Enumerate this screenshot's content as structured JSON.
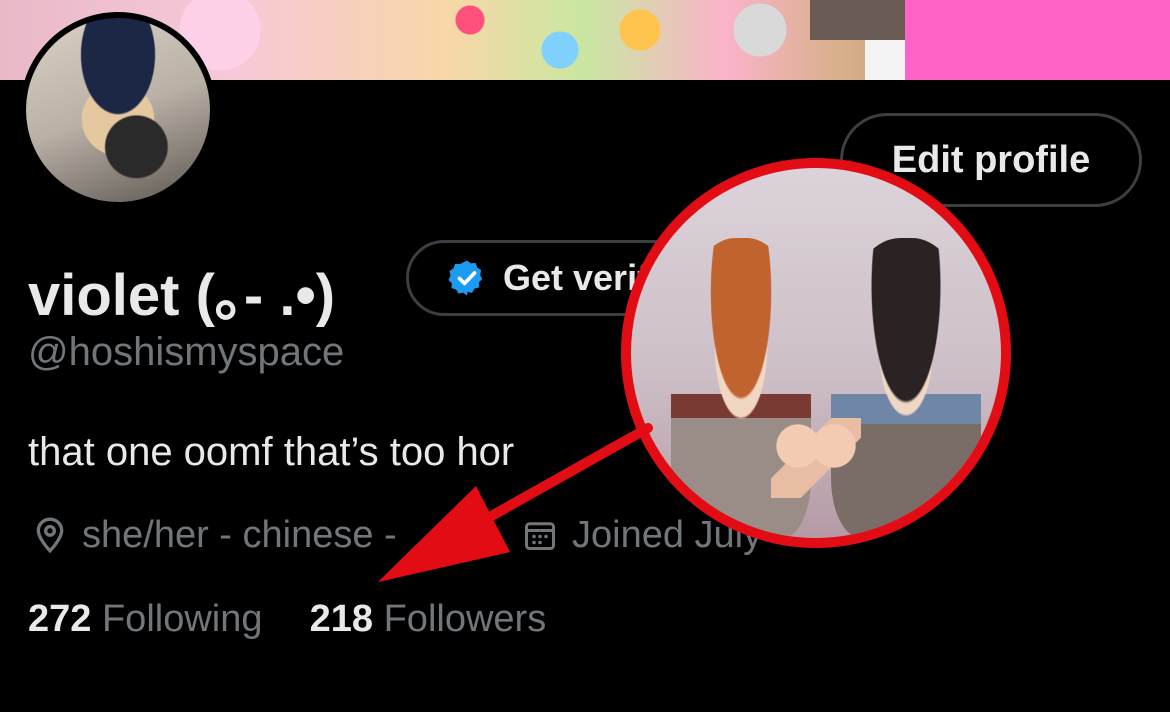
{
  "profile": {
    "display_name": "violet (｡- .•)",
    "handle": "@hoshismyspace",
    "bio": "that one oomf that’s too horny",
    "bio_visible": "that one oomf that’s too hor",
    "location": "she/her - chinese - ",
    "joined": "Joined July",
    "following_count": "272",
    "following_label": "Following",
    "followers_count": "218",
    "followers_label": "Followers"
  },
  "buttons": {
    "edit_profile": "Edit profile",
    "get_verified": "Get verified"
  },
  "icons": {
    "location": "location-pin-icon",
    "calendar": "calendar-icon",
    "verified": "verified-badge-icon"
  },
  "colors": {
    "background": "#000000",
    "primary_text": "#e7e9ea",
    "secondary_text": "#71767b",
    "border": "#3a3f44",
    "verified_blue": "#1d9bf0",
    "annotation_red": "#e20d14"
  }
}
